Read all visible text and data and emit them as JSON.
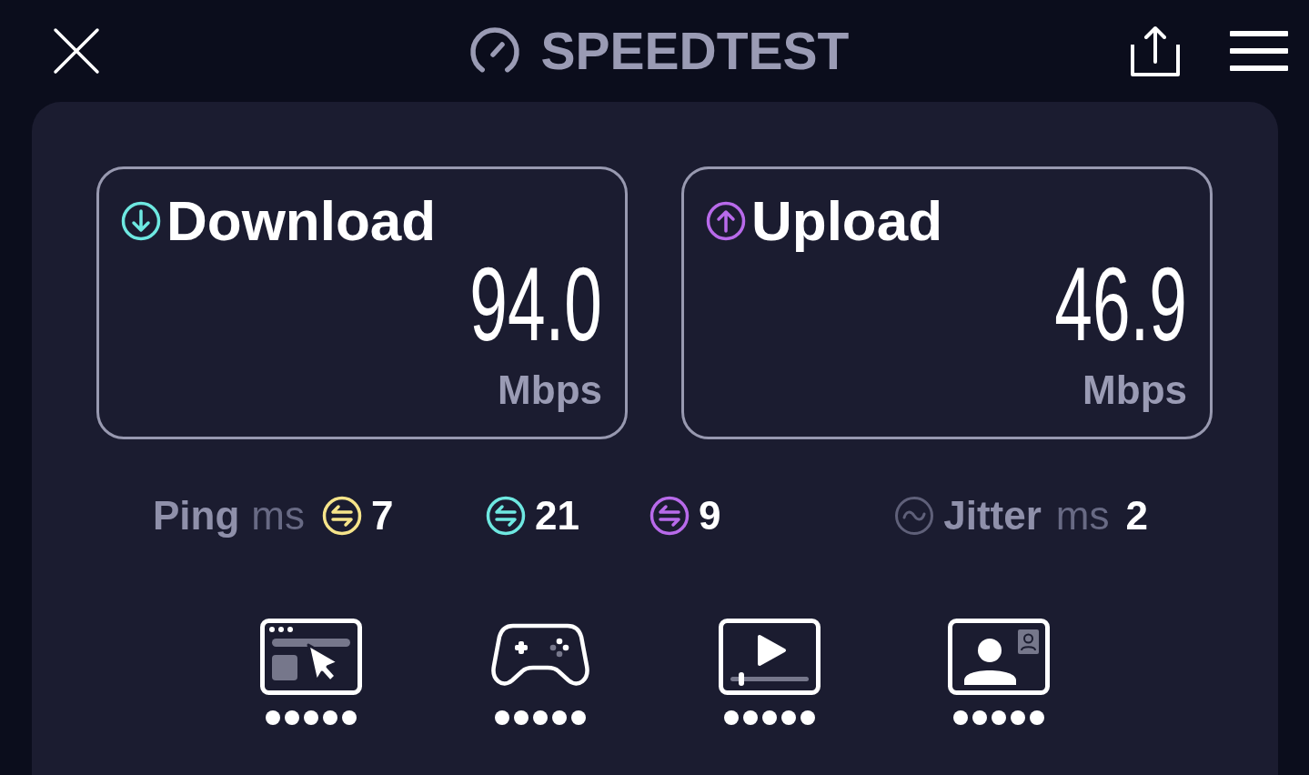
{
  "header": {
    "title": "SPEEDTEST"
  },
  "results": [
    {
      "kind": "download",
      "label": "Download",
      "value": "94.0",
      "unit": "Mbps",
      "color": "#6ee8e1"
    },
    {
      "kind": "upload",
      "label": "Upload",
      "value": "46.9",
      "unit": "Mbps",
      "color": "#b86aea"
    }
  ],
  "ping": {
    "label": "Ping",
    "unit": "ms",
    "readings": [
      {
        "value": "7",
        "color": "#f6e48a"
      },
      {
        "value": "21",
        "color": "#6ee8e1"
      },
      {
        "value": "9",
        "color": "#b86aea"
      }
    ]
  },
  "jitter": {
    "label": "Jitter",
    "unit": "ms",
    "value": "2"
  },
  "activities": [
    {
      "kind": "browsing",
      "stars": 5
    },
    {
      "kind": "gaming",
      "stars": 5
    },
    {
      "kind": "streaming",
      "stars": 5
    },
    {
      "kind": "video_call",
      "stars": 5
    }
  ]
}
